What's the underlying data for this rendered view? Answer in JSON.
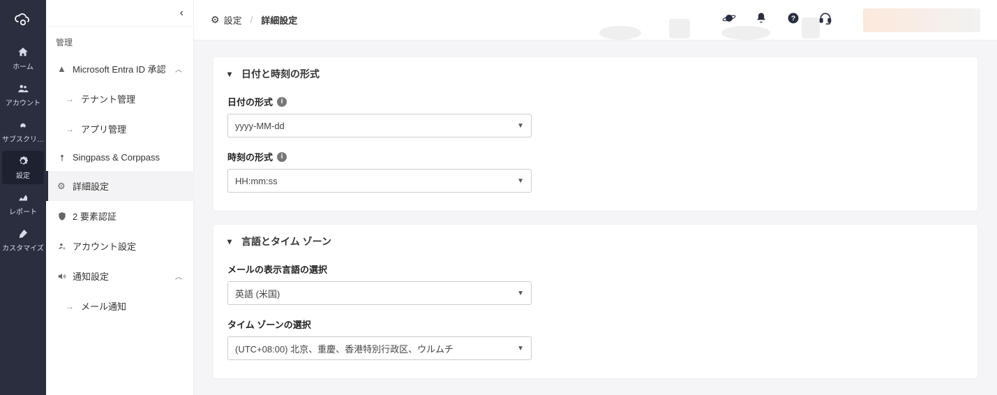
{
  "nav": {
    "items": [
      {
        "label": "ホーム"
      },
      {
        "label": "アカウント"
      },
      {
        "label": "サブスクリ…"
      },
      {
        "label": "設定"
      },
      {
        "label": "レポート"
      },
      {
        "label": "カスタマイズ"
      }
    ]
  },
  "breadcrumb": {
    "settings": "設定",
    "advanced": "詳細設定"
  },
  "sidebar": {
    "section": "管理",
    "items": {
      "entra": "Microsoft Entra ID 承認",
      "tenant": "テナント管理",
      "app": "アプリ管理",
      "singpass": "Singpass & Corppass",
      "advanced": "詳細設定",
      "mfa": "2 要素認証",
      "account": "アカウント設定",
      "notify": "通知設定",
      "mail": "メール通知"
    }
  },
  "sections": {
    "datetime": {
      "title": "日付と時刻の形式",
      "date_label": "日付の形式",
      "date_value": "yyyy-MM-dd",
      "time_label": "時刻の形式",
      "time_value": "HH:mm:ss"
    },
    "locale": {
      "title": "言語とタイム ゾーン",
      "lang_label": "メールの表示言語の選択",
      "lang_value": "英語 (米国)",
      "tz_label": "タイム ゾーンの選択",
      "tz_value": "(UTC+08:00) 北京、重慶、香港特別行政区、ウルムチ"
    }
  }
}
